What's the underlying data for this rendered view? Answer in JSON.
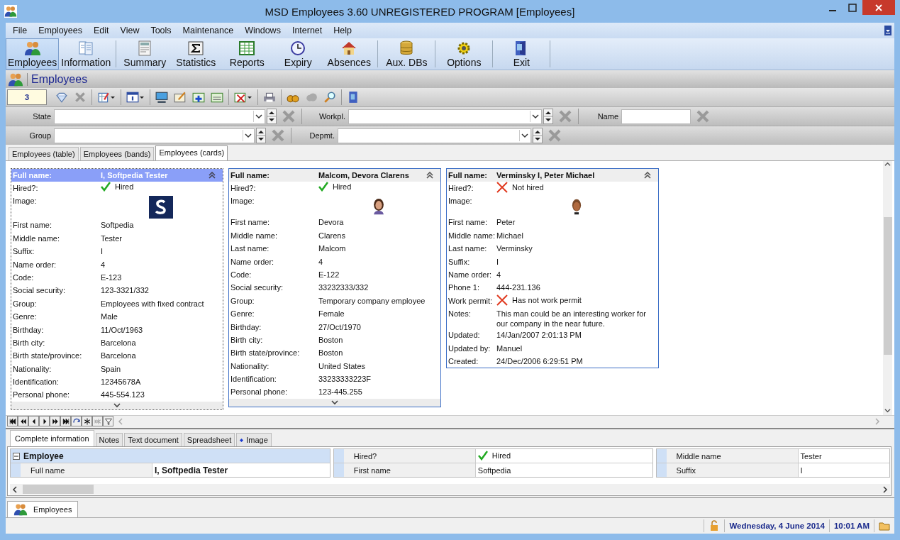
{
  "window": {
    "title": "MSD Employees 3.60 UNREGISTERED PROGRAM [Employees]"
  },
  "menu": [
    "File",
    "Employees",
    "Edit",
    "View",
    "Tools",
    "Maintenance",
    "Windows",
    "Internet",
    "Help"
  ],
  "toolbar": [
    {
      "label": "Employees",
      "selected": true
    },
    {
      "label": "Information",
      "selected": false
    },
    {
      "label": "Summary",
      "selected": false
    },
    {
      "label": "Statistics",
      "selected": false
    },
    {
      "label": "Reports",
      "selected": false
    },
    {
      "label": "Expiry",
      "selected": false
    },
    {
      "label": "Absences",
      "selected": false
    },
    {
      "label": "Aux. DBs",
      "selected": false
    },
    {
      "label": "Options",
      "selected": false
    },
    {
      "label": "Exit",
      "selected": false
    }
  ],
  "section": {
    "title": "Employees"
  },
  "record_counter": "3",
  "filters": [
    [
      {
        "label": "State",
        "kind": "combo"
      },
      {
        "label": "Workpl.",
        "kind": "combo"
      },
      {
        "label": "Name",
        "kind": "text"
      }
    ],
    [
      {
        "label": "Group",
        "kind": "combo"
      },
      {
        "label": "Depmt.",
        "kind": "combo"
      }
    ]
  ],
  "view_tabs": [
    {
      "label": "Employees (table)",
      "selected": false
    },
    {
      "label": "Employees (bands)",
      "selected": false
    },
    {
      "label": "Employees (cards)",
      "selected": true
    }
  ],
  "cards": [
    {
      "selected": true,
      "more_below": true,
      "header": {
        "label": "Full name:",
        "value": "I, Softpedia Tester"
      },
      "fields": [
        {
          "label": "Hired?:",
          "kind": "flag",
          "on": true,
          "value": "Hired"
        },
        {
          "label": "Image:"
        },
        {
          "label": "First name:",
          "kind": "text",
          "value": "Softpedia"
        },
        {
          "label": "Middle name:",
          "kind": "text",
          "value": "Tester"
        },
        {
          "label": "Suffix:",
          "kind": "text",
          "value": "I"
        },
        {
          "label": "Name order:",
          "kind": "text",
          "value": "4"
        },
        {
          "label": "Code:",
          "kind": "text",
          "value": "E-123"
        },
        {
          "label": "Social security:",
          "kind": "text",
          "value": "123-3321/332"
        },
        {
          "label": "Group:",
          "kind": "text",
          "value": "Employees with fixed contract"
        },
        {
          "label": "Genre:",
          "kind": "text",
          "value": "Male"
        },
        {
          "label": "Birthday:",
          "kind": "text",
          "value": "11/Oct/1963"
        },
        {
          "label": "Birth city:",
          "kind": "text",
          "value": "Barcelona"
        },
        {
          "label": "Birth state/province:",
          "kind": "text",
          "value": "Barcelona"
        },
        {
          "label": "Nationality:",
          "kind": "text",
          "value": "Spain"
        },
        {
          "label": "Identification:",
          "kind": "text",
          "value": "12345678A"
        },
        {
          "label": "Personal phone:",
          "kind": "text",
          "value": "445-554.123"
        }
      ]
    },
    {
      "selected": false,
      "more_below": true,
      "header": {
        "label": "Full name:",
        "value": "Malcom, Devora Clarens"
      },
      "fields": [
        {
          "label": "Hired?:",
          "kind": "flag",
          "on": true,
          "value": "Hired"
        },
        {
          "label": "Image:"
        },
        {
          "label": "First name:",
          "kind": "text",
          "value": "Devora"
        },
        {
          "label": "Middle name:",
          "kind": "text",
          "value": "Clarens"
        },
        {
          "label": "Last name:",
          "kind": "text",
          "value": "Malcom"
        },
        {
          "label": "Name order:",
          "kind": "text",
          "value": "4"
        },
        {
          "label": "Code:",
          "kind": "text",
          "value": "E-122"
        },
        {
          "label": "Social security:",
          "kind": "text",
          "value": "33232333/332"
        },
        {
          "label": "Group:",
          "kind": "text",
          "value": "Temporary company employee"
        },
        {
          "label": "Genre:",
          "kind": "text",
          "value": "Female"
        },
        {
          "label": "Birthday:",
          "kind": "text",
          "value": "27/Oct/1970"
        },
        {
          "label": "Birth city:",
          "kind": "text",
          "value": "Boston"
        },
        {
          "label": "Birth state/province:",
          "kind": "text",
          "value": "Boston"
        },
        {
          "label": "Nationality:",
          "kind": "text",
          "value": "United States"
        },
        {
          "label": "Identification:",
          "kind": "text",
          "value": "33233333223F"
        },
        {
          "label": "Personal phone:",
          "kind": "text",
          "value": "123-445.255"
        }
      ]
    },
    {
      "selected": false,
      "more_below": false,
      "header": {
        "label": "Full name:",
        "value": "Verminsky I, Peter Michael"
      },
      "fields": [
        {
          "label": "Hired?:",
          "kind": "flag",
          "on": false,
          "value": "Not hired"
        },
        {
          "label": "Image:"
        },
        {
          "label": "First name:",
          "kind": "text",
          "value": "Peter"
        },
        {
          "label": "Middle name:",
          "kind": "text",
          "value": "Michael"
        },
        {
          "label": "Last name:",
          "kind": "text",
          "value": "Verminsky"
        },
        {
          "label": "Suffix:",
          "kind": "text",
          "value": "I"
        },
        {
          "label": "Name order:",
          "kind": "text",
          "value": "4"
        },
        {
          "label": "Phone 1:",
          "kind": "text",
          "value": "444-231.136"
        },
        {
          "label": "Work permit:",
          "kind": "flag",
          "on": false,
          "value": "Has not work permit"
        },
        {
          "label": "Notes:",
          "kind": "text",
          "value": "This man could be an interesting worker for our company in the near future."
        },
        {
          "label": "Updated:",
          "kind": "text",
          "value": "14/Jan/2007 2:01:13 PM"
        },
        {
          "label": "Updated by:",
          "kind": "text",
          "value": "Manuel"
        },
        {
          "label": "Created:",
          "kind": "text",
          "value": "24/Dec/2006 6:29:51 PM"
        }
      ]
    }
  ],
  "detail_tabs": [
    {
      "label": "Complete information",
      "selected": true,
      "dot": false
    },
    {
      "label": "Notes",
      "selected": false,
      "dot": false
    },
    {
      "label": "Text document",
      "selected": false,
      "dot": false
    },
    {
      "label": "Spreadsheet",
      "selected": false,
      "dot": false
    },
    {
      "label": "Image",
      "selected": false,
      "dot": true
    }
  ],
  "detail_grid": {
    "group": {
      "title": "Employee",
      "expanded": true
    },
    "columns": [
      [
        {
          "label": "Full name",
          "kind": "text",
          "value": "I, Softpedia Tester",
          "bold": true
        }
      ],
      [
        {
          "label": "Hired?",
          "kind": "flag",
          "on": true,
          "value": "Hired",
          "bold": false
        },
        {
          "label": "First name",
          "kind": "text",
          "value": "Softpedia",
          "bold": false
        }
      ],
      [
        {
          "label": "Middle name",
          "kind": "text",
          "value": "Tester",
          "bold": false
        },
        {
          "label": "Suffix",
          "kind": "text",
          "value": "I",
          "bold": false
        }
      ]
    ]
  },
  "documents": [
    {
      "label": "Employees",
      "selected": true
    }
  ],
  "status_bar": {
    "date": "Wednesday, 4 June 2014",
    "time": "10:01 AM"
  }
}
